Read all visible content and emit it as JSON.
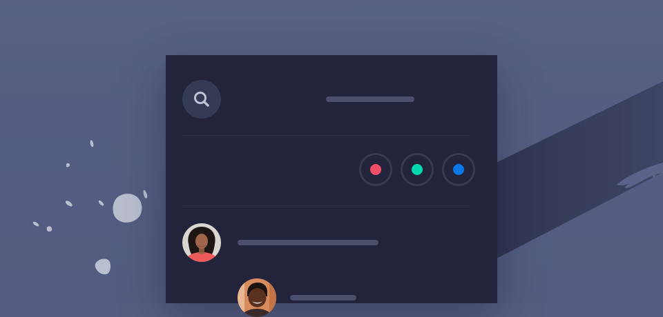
{
  "colors": {
    "background": "#555e82",
    "panel": "#21243a",
    "placeholder_bar": "#4a4f6d",
    "dot_red": "#f24e6a",
    "dot_teal": "#00d9b0",
    "dot_blue": "#0b78e3"
  },
  "header": {
    "search_icon": "search-icon"
  },
  "color_options": [
    {
      "name": "red",
      "color": "#f24e6a"
    },
    {
      "name": "teal",
      "color": "#00d9b0"
    },
    {
      "name": "blue",
      "color": "#0b78e3"
    }
  ],
  "list": {
    "items": [
      {
        "avatar": "avatar-woman-curly-hair"
      },
      {
        "avatar": "avatar-man-smiling"
      }
    ]
  }
}
